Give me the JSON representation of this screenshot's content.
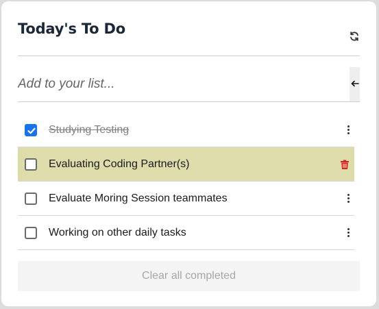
{
  "header": {
    "title": "Today's To Do"
  },
  "add": {
    "placeholder": "Add to your list..."
  },
  "items": [
    {
      "label": "Studying Testing",
      "completed": true,
      "state": "normal"
    },
    {
      "label": "Evaluating Coding Partner(s)",
      "completed": false,
      "state": "hovered"
    },
    {
      "label": "Evaluate Moring Session teammates",
      "completed": false,
      "state": "normal"
    },
    {
      "label": "Working on other daily tasks",
      "completed": false,
      "state": "normal"
    }
  ],
  "footer": {
    "clear_label": "Clear all completed"
  },
  "colors": {
    "highlight": "#dddcaa",
    "checkbox_checked": "#1a73e8",
    "delete": "#e02020",
    "title": "#1b2738"
  }
}
